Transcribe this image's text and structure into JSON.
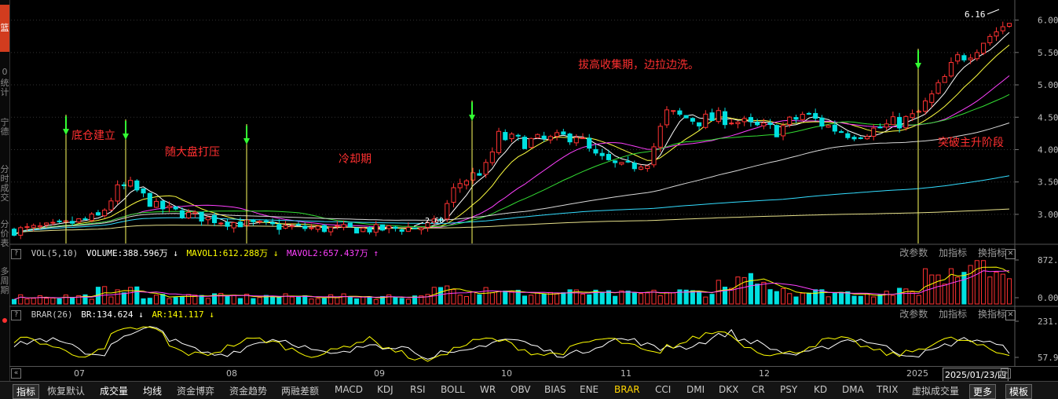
{
  "chart_data": [
    {
      "type": "candlestick",
      "x_ticks": [
        "07",
        "08",
        "09",
        "10",
        "11",
        "12",
        "2025"
      ],
      "y_ticks": [
        3.0,
        3.5,
        4.0,
        4.5,
        5.0,
        5.5,
        6.0
      ],
      "ylim": [
        2.55,
        6.25
      ],
      "high_label": "6.16",
      "low_label": "2.60",
      "moving_averages": [
        "white",
        "yellow",
        "magenta",
        "green",
        "light-gray",
        "cyan",
        "khaki"
      ],
      "annotations": [
        "底仓建立",
        "随大盘打压",
        "冷却期",
        "拔高收集期，边拉边洗。",
        "突破主升阶段"
      ]
    },
    {
      "type": "bar",
      "name": "VOL(5,10)",
      "readout": {
        "volume": "VOLUME:388.596万",
        "mavol1": "MAVOL1:612.288万",
        "mavol2": "MAVOL2:657.437万"
      },
      "y_ticks": [
        "872.00",
        "0.00"
      ],
      "ylim": [
        0,
        872
      ]
    },
    {
      "type": "line",
      "name": "BRAR(26)",
      "readout": {
        "br": "BR:134.624",
        "ar": "AR:141.117"
      },
      "y_ticks": [
        "231.25",
        "57.92"
      ],
      "ylim": [
        57.92,
        231.25
      ]
    }
  ],
  "panel_links": {
    "params": "改参数",
    "add": "加指标",
    "switch": "换指标",
    "close": "✕"
  },
  "arrows": {
    "down": "↓",
    "up": "↑"
  },
  "help": "?",
  "left_tabs": [
    "篮",
    "0",
    "统计",
    "宁德",
    "分时成交",
    "分价表",
    "多周期"
  ],
  "xaxis": {
    "date": "2025/01/23/四",
    "prev": "«",
    "next": "»"
  },
  "bottom_tabs": [
    "指标",
    "恢复默认",
    "成交量",
    "均线",
    "资金博弈",
    "资金趋势",
    "两融差额",
    "MACD",
    "KDJ",
    "RSI",
    "BOLL",
    "WR",
    "OBV",
    "BIAS",
    "ENE",
    "BRAR",
    "CCI",
    "DMI",
    "DKX",
    "CR",
    "PSY",
    "KD",
    "DMA",
    "TRIX",
    "虚拟成交量",
    "更多",
    "模板"
  ],
  "colors": {
    "up": "#ff3232",
    "down": "#00e0e0",
    "mavol1": "#ffff00",
    "mavol2": "#ff40ff",
    "br": "#ffffff",
    "ar": "#ffff00",
    "marker": "#ffff60",
    "arrow": "#33ff33"
  }
}
